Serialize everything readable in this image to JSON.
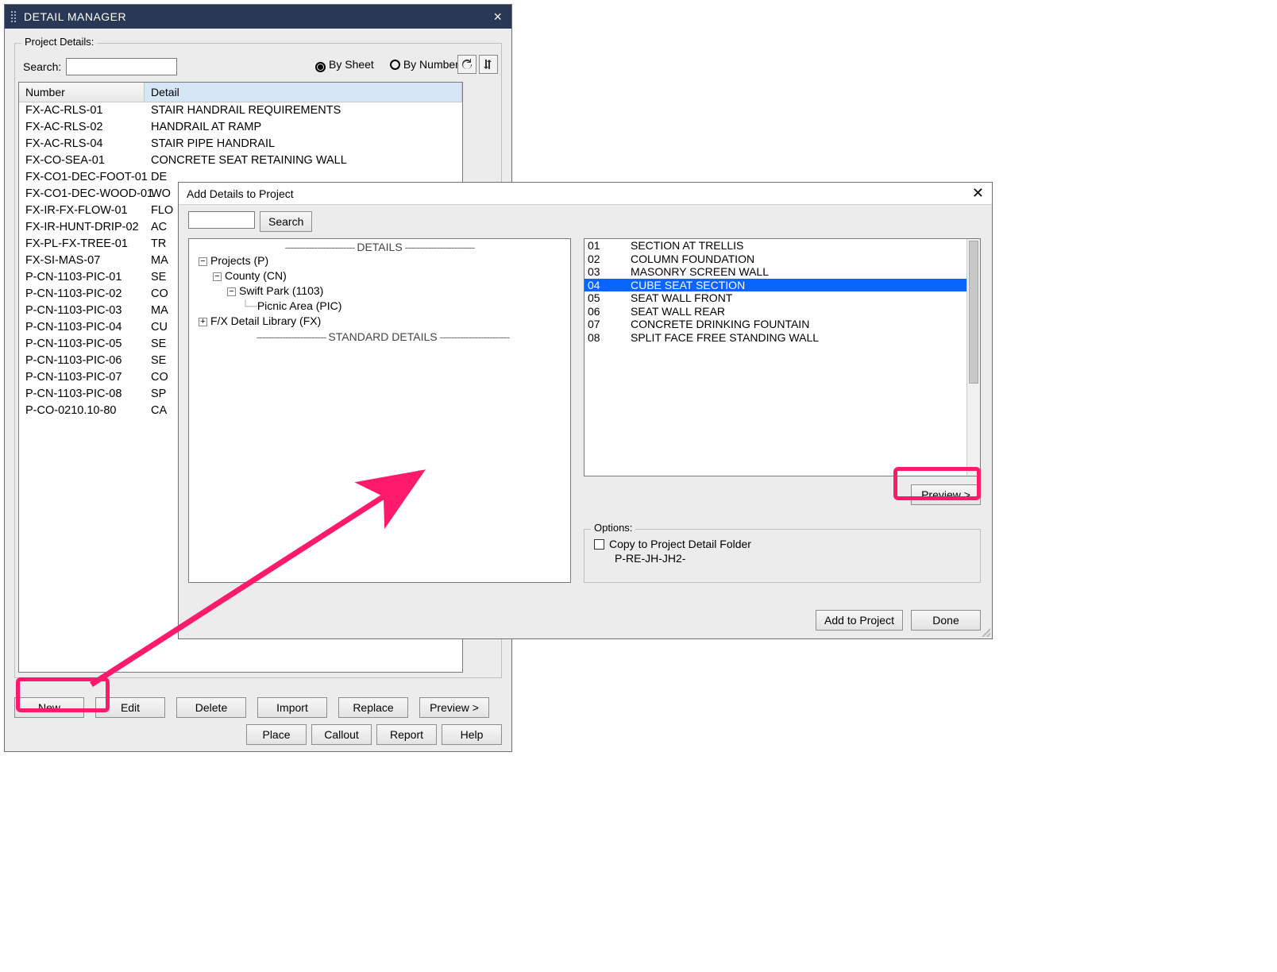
{
  "detail_manager": {
    "title": "DETAIL MANAGER",
    "group_label": "Project Details:",
    "search_label": "Search:",
    "sort": {
      "by_sheet": "By Sheet",
      "by_number": "By Number",
      "selected": "by_sheet"
    },
    "columns": {
      "number": "Number",
      "detail": "Detail"
    },
    "rows": [
      {
        "num": "FX-AC-RLS-01",
        "det": "STAIR HANDRAIL REQUIREMENTS"
      },
      {
        "num": "FX-AC-RLS-02",
        "det": "HANDRAIL AT RAMP"
      },
      {
        "num": "FX-AC-RLS-04",
        "det": "STAIR PIPE HANDRAIL"
      },
      {
        "num": "FX-CO-SEA-01",
        "det": "CONCRETE SEAT RETAINING WALL"
      },
      {
        "num": "FX-CO1-DEC-FOOT-01",
        "det": "DE"
      },
      {
        "num": "FX-CO1-DEC-WOOD-01",
        "det": "WO"
      },
      {
        "num": "FX-IR-FX-FLOW-01",
        "det": "FLO"
      },
      {
        "num": "FX-IR-HUNT-DRIP-02",
        "det": "AC"
      },
      {
        "num": "FX-PL-FX-TREE-01",
        "det": "TR"
      },
      {
        "num": "FX-SI-MAS-07",
        "det": "MA"
      },
      {
        "num": "P-CN-1103-PIC-01",
        "det": "SE"
      },
      {
        "num": "P-CN-1103-PIC-02",
        "det": "CO"
      },
      {
        "num": "P-CN-1103-PIC-03",
        "det": "MA"
      },
      {
        "num": "P-CN-1103-PIC-04",
        "det": "CU"
      },
      {
        "num": "P-CN-1103-PIC-05",
        "det": "SE"
      },
      {
        "num": "P-CN-1103-PIC-06",
        "det": "SE"
      },
      {
        "num": "P-CN-1103-PIC-07",
        "det": "CO"
      },
      {
        "num": "P-CN-1103-PIC-08",
        "det": "SP"
      },
      {
        "num": "P-CO-0210.10-80",
        "det": "CA"
      }
    ],
    "buttons_row1": {
      "new": "New",
      "edit": "Edit",
      "delete": "Delete",
      "import": "Import",
      "replace": "Replace",
      "preview": "Preview >"
    },
    "buttons_row2": {
      "place": "Place",
      "callout": "Callout",
      "report": "Report",
      "help": "Help"
    }
  },
  "add_dialog": {
    "title": "Add Details to Project",
    "search_button": "Search",
    "tree_headers": {
      "details": "DETAILS",
      "standard": "STANDARD DETAILS"
    },
    "tree": {
      "projects": "Projects (P)",
      "county": "County (CN)",
      "swift": "Swift Park (1103)",
      "picnic": "Picnic Area (PIC)",
      "fx_lib": "F/X Detail Library (FX)"
    },
    "list": [
      {
        "num": "01",
        "name": "SECTION AT TRELLIS"
      },
      {
        "num": "02",
        "name": "COLUMN FOUNDATION"
      },
      {
        "num": "03",
        "name": "MASONRY SCREEN WALL"
      },
      {
        "num": "04",
        "name": "CUBE SEAT SECTION",
        "selected": true
      },
      {
        "num": "05",
        "name": "SEAT WALL FRONT"
      },
      {
        "num": "06",
        "name": "SEAT WALL REAR"
      },
      {
        "num": "07",
        "name": "CONCRETE DRINKING FOUNTAIN"
      },
      {
        "num": "08",
        "name": "SPLIT FACE FREE STANDING WALL"
      }
    ],
    "preview_button": "Preview >",
    "options": {
      "label": "Options:",
      "copy_label": "Copy to Project Detail Folder",
      "path": "P-RE-JH-JH2-"
    },
    "buttons": {
      "add": "Add to Project",
      "done": "Done"
    }
  }
}
